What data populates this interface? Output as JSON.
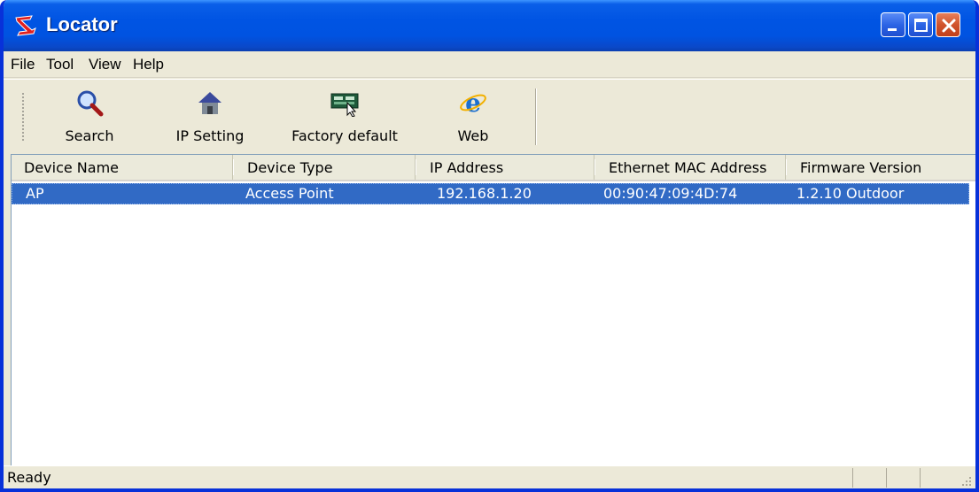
{
  "window": {
    "title": "Locator",
    "app_icon": "locator-logo-icon"
  },
  "menu": [
    {
      "label": "File"
    },
    {
      "label": "Tool"
    },
    {
      "label": "View"
    },
    {
      "label": "Help"
    }
  ],
  "toolbar": {
    "buttons": [
      {
        "label": "Search",
        "icon": "magnifier-icon"
      },
      {
        "label": "IP Setting",
        "icon": "house-icon"
      },
      {
        "label": "Factory default",
        "icon": "factory-reset-icon"
      },
      {
        "label": "Web",
        "icon": "internet-explorer-icon"
      }
    ]
  },
  "list": {
    "columns": [
      "Device Name",
      "Device Type",
      "IP Address",
      "Ethernet MAC Address",
      "Firmware Version"
    ],
    "rows": [
      {
        "device_name": "AP",
        "device_type": "Access Point",
        "ip_address": "192.168.1.20",
        "mac_address": "00:90:47:09:4D:74",
        "firmware": "1.2.10 Outdoor",
        "selected": true
      }
    ]
  },
  "status": {
    "text": "Ready"
  },
  "colors": {
    "titlebar": "#0054e3",
    "selection": "#316ac5",
    "window_face": "#ece9d8"
  }
}
